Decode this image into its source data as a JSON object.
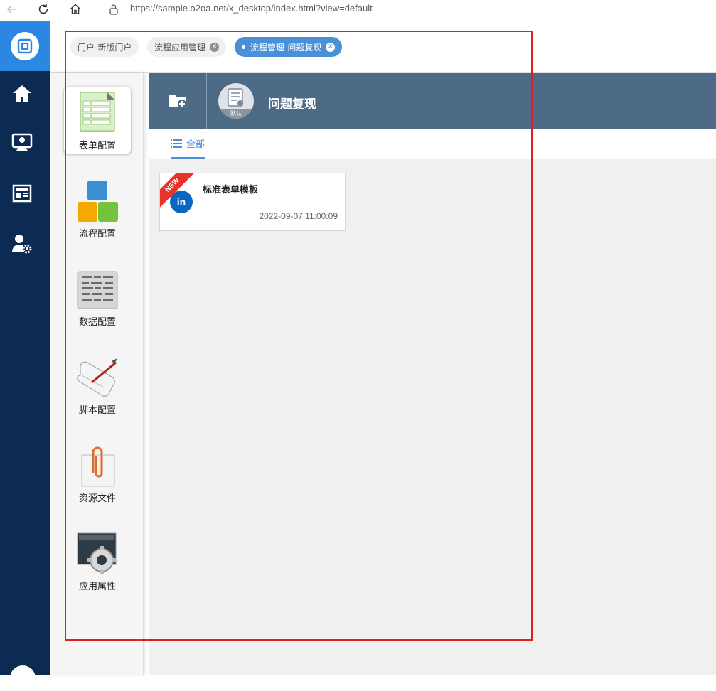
{
  "browser": {
    "url": "https://sample.o2oa.net/x_desktop/index.html?view=default",
    "back_icon": "arrow-left-icon",
    "reload_icon": "reload-icon",
    "home_icon": "home-icon",
    "lock_icon": "lock-icon"
  },
  "left_nav": {
    "logo_icon": "o2oa-logo-icon",
    "items": [
      {
        "icon": "home-icon"
      },
      {
        "icon": "meeting-icon"
      },
      {
        "icon": "news-icon"
      },
      {
        "icon": "user-settings-icon"
      }
    ],
    "accent_color": "#2b87e0",
    "background_color": "#0b2b52"
  },
  "tabs": [
    {
      "label": "门户-新版门户",
      "closable": false,
      "active": false
    },
    {
      "label": "流程应用管理",
      "closable": true,
      "active": false
    },
    {
      "label": "流程管理-问题复现",
      "closable": true,
      "active": true
    }
  ],
  "tools": [
    {
      "label": "表单配置",
      "icon": "form-config-icon",
      "selected": true
    },
    {
      "label": "流程配置",
      "icon": "process-config-icon",
      "selected": false
    },
    {
      "label": "数据配置",
      "icon": "data-config-icon",
      "selected": false
    },
    {
      "label": "脚本配置",
      "icon": "script-config-icon",
      "selected": false
    },
    {
      "label": "资源文件",
      "icon": "resource-file-icon",
      "selected": false
    },
    {
      "label": "应用属性",
      "icon": "app-properties-icon",
      "selected": false
    }
  ],
  "header": {
    "add_icon": "add-folder-icon",
    "app_icon_badge": "默认",
    "title": "问题复现",
    "background_color": "#4d6a87"
  },
  "filter": {
    "active_tab": "全部",
    "icon": "list-icon"
  },
  "forms": [
    {
      "title": "标准表单模板",
      "date": "2022-09-07 11:00:09",
      "badge": "NEW",
      "icon": "linkedin-icon",
      "icon_text": "in"
    }
  ]
}
